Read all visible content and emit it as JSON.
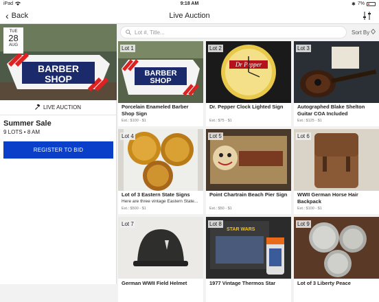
{
  "status_bar": {
    "device": "iPad",
    "time": "9:18 AM",
    "battery": "7%"
  },
  "nav": {
    "back_label": "Back",
    "title": "Live Auction"
  },
  "sale": {
    "weekday": "TUE",
    "day": "28",
    "month": "AUG",
    "hero_sign_line1": "BARBER",
    "hero_sign_line2": "SHOP",
    "live_label": "LIVE AUCTION",
    "title": "Summer Sale",
    "meta": "9 LOTS • 8 AM",
    "register_label": "REGISTER TO BID"
  },
  "search": {
    "placeholder": "Lot #, Title...",
    "sort_label": "Sort By"
  },
  "lots": [
    {
      "lot": "Lot 1",
      "title": "Porcelain Enameled Barber Shop Sign",
      "desc": "",
      "est": "Est.: $100 - $1"
    },
    {
      "lot": "Lot 2",
      "title": "Dr. Pepper Clock Lighted Sign",
      "desc": "",
      "est": "Est.: $75 - $1"
    },
    {
      "lot": "Lot 3",
      "title": "Autographed Blake Shelton Guitar COA Included",
      "desc": "",
      "est": "Est.: $125 - $1"
    },
    {
      "lot": "Lot 4",
      "title": "Lot of 3 Eastern State Signs",
      "desc": "Here are three vintage Eastern State...",
      "est": "Est.: $500 - $1"
    },
    {
      "lot": "Lot 5",
      "title": "Point Chartrain Beach Pier Sign",
      "desc": "",
      "est": "Est.: $50 - $1"
    },
    {
      "lot": "Lot 6",
      "title": "WWII German Horse Hair Backpack",
      "desc": "",
      "est": "Est.: $100 - $1"
    },
    {
      "lot": "Lot 7",
      "title": "German WWII Field Helmet",
      "desc": "",
      "est": ""
    },
    {
      "lot": "Lot 8",
      "title": "1977 Vintage Thermos Star",
      "desc": "",
      "est": ""
    },
    {
      "lot": "Lot 9",
      "title": "Lot of 3 Liberty Peace",
      "desc": "",
      "est": ""
    }
  ],
  "image_text": {
    "lot1_line1": "BARBER",
    "lot1_line2": "SHOP",
    "lot2_brand": "Dr Pepper",
    "lot8_brand": "STAR WARS"
  },
  "colors": {
    "register_bg": "#0a3fc9",
    "accent_text": "#ffffff"
  }
}
